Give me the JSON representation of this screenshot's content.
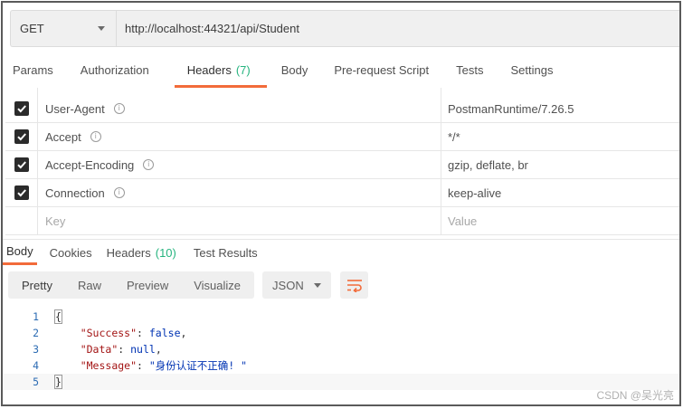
{
  "request": {
    "method": "GET",
    "url": "http://localhost:44321/api/Student"
  },
  "req_tabs": {
    "params": "Params",
    "authorization": "Authorization",
    "headers": "Headers",
    "headers_count": "(7)",
    "body": "Body",
    "prerequest": "Pre-request Script",
    "tests": "Tests",
    "settings": "Settings"
  },
  "headers": [
    {
      "key": "User-Agent",
      "value": "PostmanRuntime/7.26.5",
      "checked": true
    },
    {
      "key": "Accept",
      "value": "*/*",
      "checked": true
    },
    {
      "key": "Accept-Encoding",
      "value": "gzip, deflate, br",
      "checked": true
    },
    {
      "key": "Connection",
      "value": "keep-alive",
      "checked": true
    }
  ],
  "new_header": {
    "key_placeholder": "Key",
    "value_placeholder": "Value"
  },
  "resp_tabs": {
    "body": "Body",
    "cookies": "Cookies",
    "headers": "Headers",
    "headers_count": "(10)",
    "test_results": "Test Results"
  },
  "toolbar": {
    "pretty": "Pretty",
    "raw": "Raw",
    "preview": "Preview",
    "visualize": "Visualize",
    "format": "JSON"
  },
  "code": {
    "lines": [
      "1",
      "2",
      "3",
      "4",
      "5"
    ],
    "open": "{",
    "close": "}",
    "success_key": "\"Success\"",
    "success_val": "false",
    "data_key": "\"Data\"",
    "data_val": "null",
    "message_key": "\"Message\"",
    "message_val": "\"身份认证不正确! \""
  },
  "watermark": "CSDN @吴光亮",
  "colors": {
    "accent": "#f26b3a",
    "count_green": "#26b47f"
  }
}
